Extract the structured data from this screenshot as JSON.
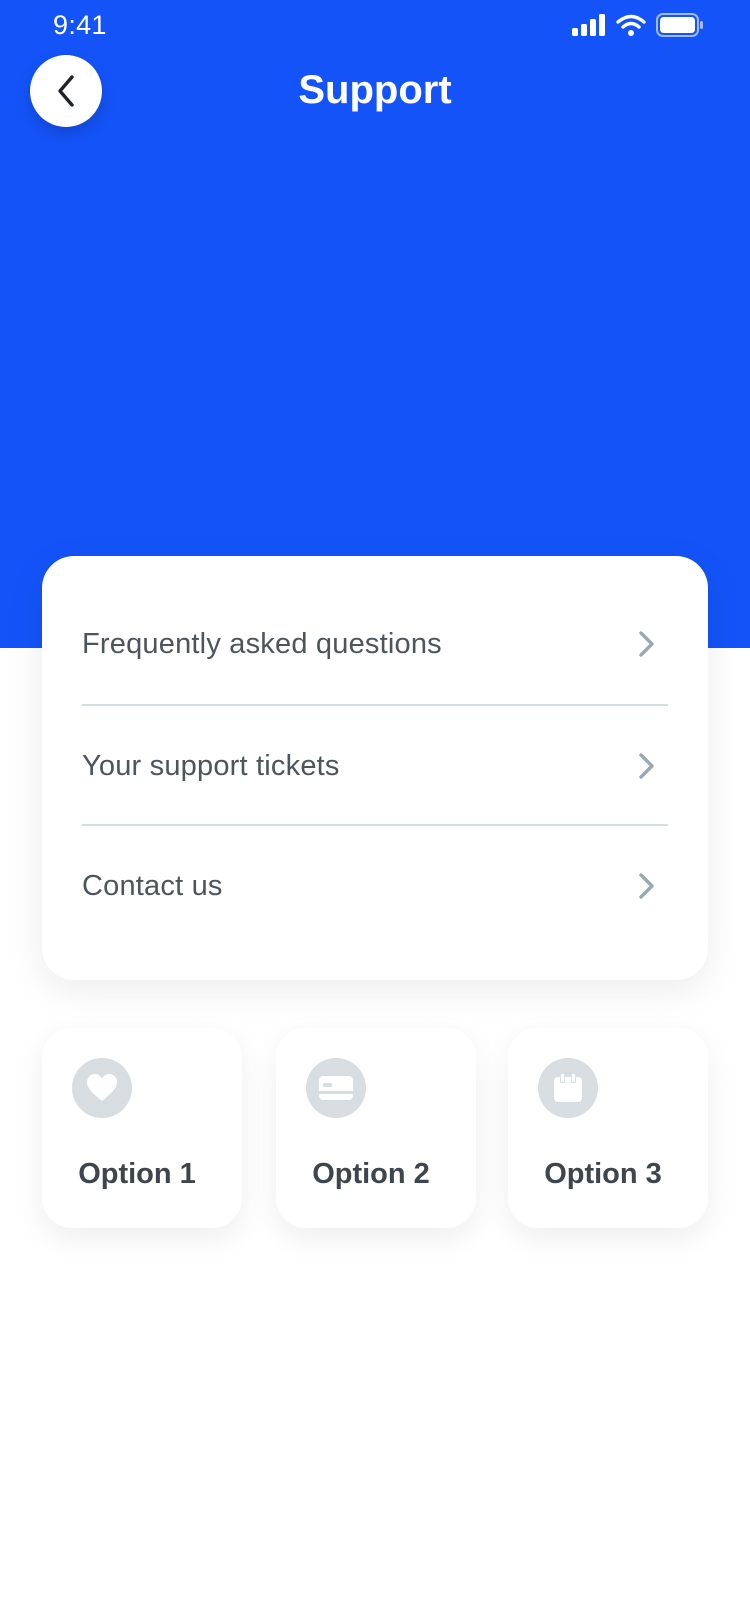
{
  "status_bar": {
    "time": "9:41",
    "icons": [
      "cellular-signal-icon",
      "wifi-icon",
      "battery-icon"
    ]
  },
  "header": {
    "title": "Support",
    "back_icon": "chevron-left-icon"
  },
  "menu": {
    "items": [
      {
        "label": "Frequently asked questions",
        "icon": "chevron-right-icon"
      },
      {
        "label": "Your support tickets",
        "icon": "chevron-right-icon"
      },
      {
        "label": "Contact us",
        "icon": "chevron-right-icon"
      }
    ]
  },
  "options": [
    {
      "label": "Option 1",
      "icon": "heart-icon"
    },
    {
      "label": "Option 2",
      "icon": "credit-card-icon"
    },
    {
      "label": "Option 3",
      "icon": "calendar-icon"
    }
  ],
  "colors": {
    "header_background": "#1453f7",
    "text_primary": "#4c545c",
    "icon_muted": "#d7dde0",
    "chevron": "#9aa8b3"
  }
}
